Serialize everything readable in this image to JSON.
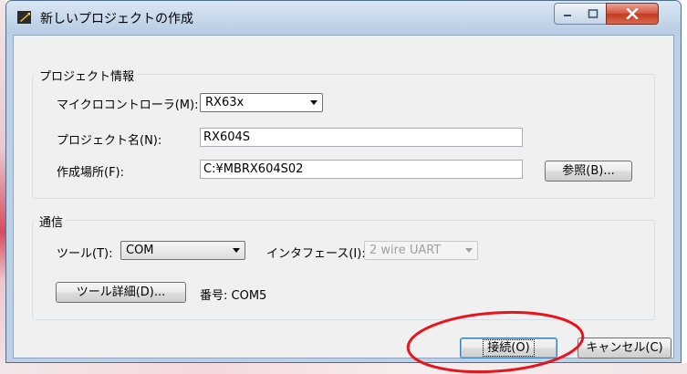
{
  "window": {
    "title": "新しいプロジェクトの作成",
    "controls": {
      "minimize_icon": "minimize-icon",
      "maximize_icon": "maximize-icon",
      "close_icon": "close-icon"
    }
  },
  "project_group": {
    "label": "プロジェクト情報",
    "microcontroller": {
      "label": "マイクロコントローラ(M):",
      "value": "RX63x"
    },
    "project_name": {
      "label": "プロジェクト名(N):",
      "value": "RX604S"
    },
    "location": {
      "label": "作成場所(F):",
      "value": "C:¥MBRX604S02"
    },
    "browse_button": "参照(B)..."
  },
  "comm_group": {
    "label": "通信",
    "tool": {
      "label": "ツール(T):",
      "value": "COM"
    },
    "interface": {
      "label": "インタフェース(I):",
      "value": "2 wire UART"
    },
    "tool_details_button": "ツール詳細(D)...",
    "port_number": "番号: COM5"
  },
  "footer": {
    "connect_button": "接続(O)",
    "cancel_button": "キャンセル(C)"
  },
  "annotation": {
    "color": "#e8141b"
  }
}
